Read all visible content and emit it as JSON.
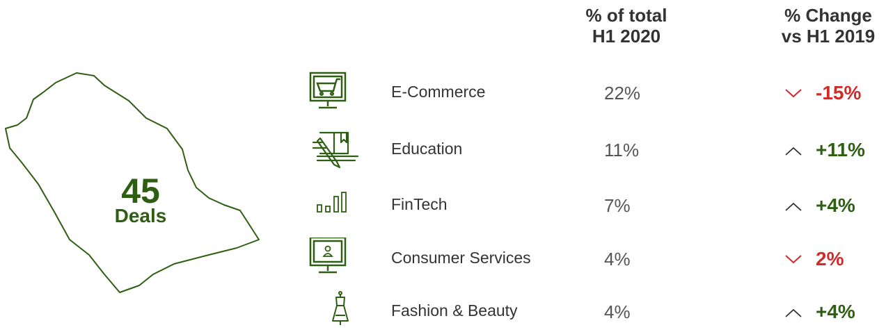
{
  "colors": {
    "green": "#2e5e12",
    "red": "#d12a2a",
    "text": "#333333"
  },
  "summary": {
    "count": "45",
    "unit": "Deals"
  },
  "headers": {
    "share_line1": "% of total",
    "share_line2": "H1 2020",
    "change_line1": "% Change",
    "change_line2": "vs H1 2019"
  },
  "chart_data": {
    "type": "table",
    "columns": [
      "% of total H1 2020",
      "% Change vs H1 2019"
    ],
    "rows": [
      {
        "sector": "E-Commerce",
        "icon": "shopping-cart-monitor-icon",
        "share": "22%",
        "change": "-15%",
        "direction": "down"
      },
      {
        "sector": "Education",
        "icon": "book-pencil-icon",
        "share": "11%",
        "change": "+11%",
        "direction": "up"
      },
      {
        "sector": "FinTech",
        "icon": "bar-chart-icon",
        "share": "7%",
        "change": "+4%",
        "direction": "up"
      },
      {
        "sector": "Consumer Services",
        "icon": "person-monitor-icon",
        "share": "4%",
        "change": "2%",
        "direction": "down"
      },
      {
        "sector": "Fashion & Beauty",
        "icon": "dress-icon",
        "share": "4%",
        "change": "+4%",
        "direction": "up"
      }
    ]
  }
}
